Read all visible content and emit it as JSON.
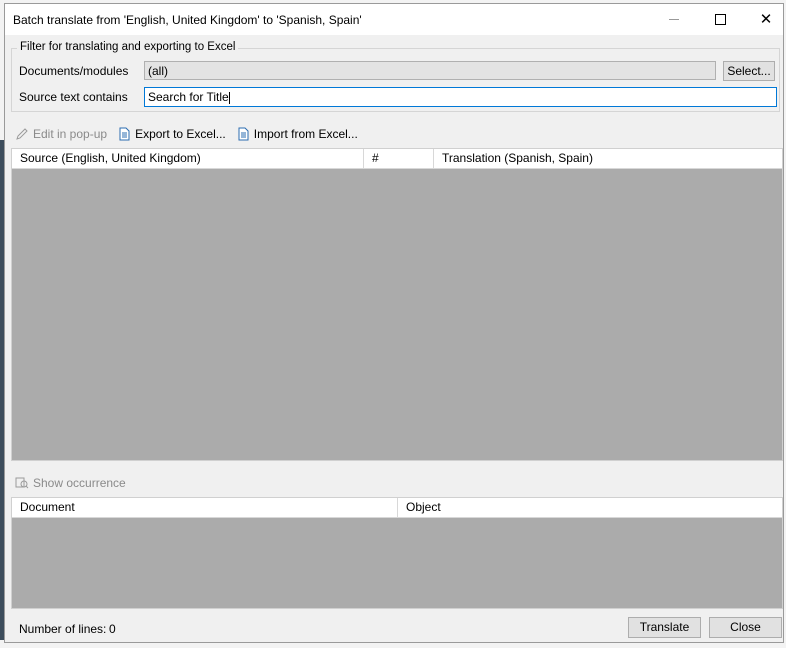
{
  "window": {
    "title": "Batch translate from 'English, United Kingdom' to 'Spanish, Spain'"
  },
  "filter": {
    "group_label": "Filter for translating and exporting to Excel",
    "documents_label": "Documents/modules",
    "documents_value": "(all)",
    "select_button": "Select...",
    "source_label": "Source text contains",
    "source_value": "Search for Title"
  },
  "toolbar": {
    "edit_popup": "Edit in pop-up",
    "export_excel": "Export to Excel...",
    "import_excel": "Import from Excel..."
  },
  "translation_grid": {
    "columns": [
      "Source (English, United Kingdom)",
      "#",
      "Translation (Spanish, Spain)"
    ]
  },
  "occurrence": {
    "show_occurrence": "Show occurrence"
  },
  "occurrence_grid": {
    "columns": [
      "Document",
      "Object"
    ]
  },
  "footer": {
    "lines_label": "Number of lines:",
    "lines_value": "0",
    "translate_button": "Translate",
    "close_button": "Close"
  },
  "icons": {
    "pencil": "pencil-icon",
    "excel_export": "document-icon",
    "excel_import": "document-icon",
    "occurrence": "find-occurrence-icon"
  }
}
